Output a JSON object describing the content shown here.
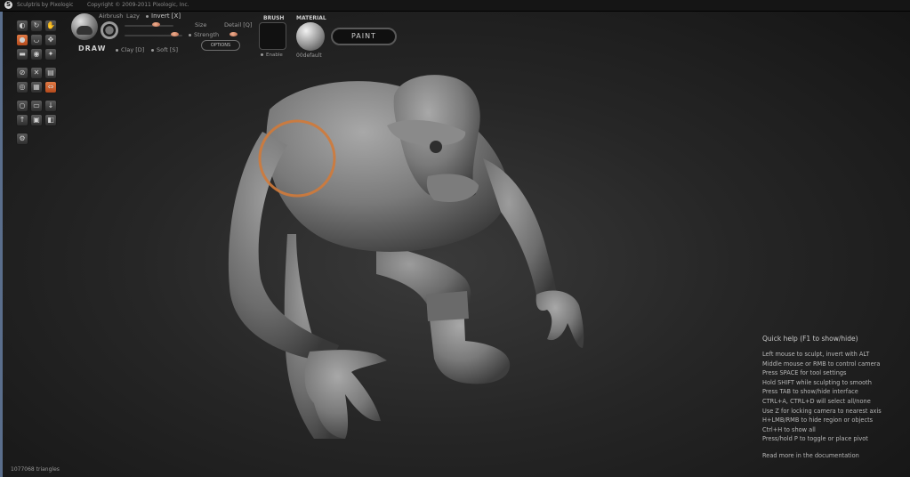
{
  "titlebar": {
    "app_name": "Sculptris by Pixologic",
    "copyright": "Copyright © 2009-2011 Pixologic, Inc."
  },
  "tool_icons": [
    "sculpt-tool-icon",
    "rotate-tool-icon",
    "grab-tool-icon",
    "draw-tool-icon",
    "crease-tool-icon",
    "move-tool-icon",
    "flatten-tool-icon",
    "inflate-tool-icon",
    "pinch-tool-icon",
    "symmetry-tool-icon",
    "mask-tool-icon",
    "reduce-tool-icon",
    "subdivide-tool-icon",
    "wireframe-tool-icon",
    "scale-tool-icon",
    "new-sphere-icon",
    "new-plane-icon",
    "import-icon",
    "export-icon",
    "save-icon",
    "load-icon",
    "options-icon"
  ],
  "draw_panel": {
    "draw_label": "DRAW",
    "airbrush": "Airbrush",
    "lazy": "Lazy",
    "invert": "Invert [X]",
    "size": "Size",
    "detail": "Detail [Q]",
    "strength": "Strength",
    "options_button": "OPTIONS",
    "clay": "Clay [D]",
    "soft": "Soft [S]"
  },
  "brush_panel": {
    "heading": "BRUSH",
    "enable": "Enable"
  },
  "material_panel": {
    "heading": "MATERIAL",
    "name": "00default"
  },
  "paint_button": "PAINT",
  "colors": {
    "accent": "#e06a2e",
    "brush_ring": "#d07a3a",
    "sidebar_edge": "#5a6e8c"
  },
  "quick_help": {
    "title": "Quick help (F1 to show/hide)",
    "lines": [
      "Left mouse to sculpt, invert with ALT",
      "Middle mouse or RMB to control camera",
      "Press SPACE for tool settings",
      "Hold SHIFT while sculpting to smooth",
      "Press TAB to show/hide interface",
      "CTRL+A, CTRL+D will select all/none",
      "Use Z for locking camera to nearest axis",
      "H+LMB/RMB to hide region or objects",
      "Ctrl+H to show all",
      "Press/hold P to toggle or place pivot"
    ],
    "docs_link": "Read more in the documentation"
  },
  "status": {
    "triangles": "1077068 triangles"
  }
}
